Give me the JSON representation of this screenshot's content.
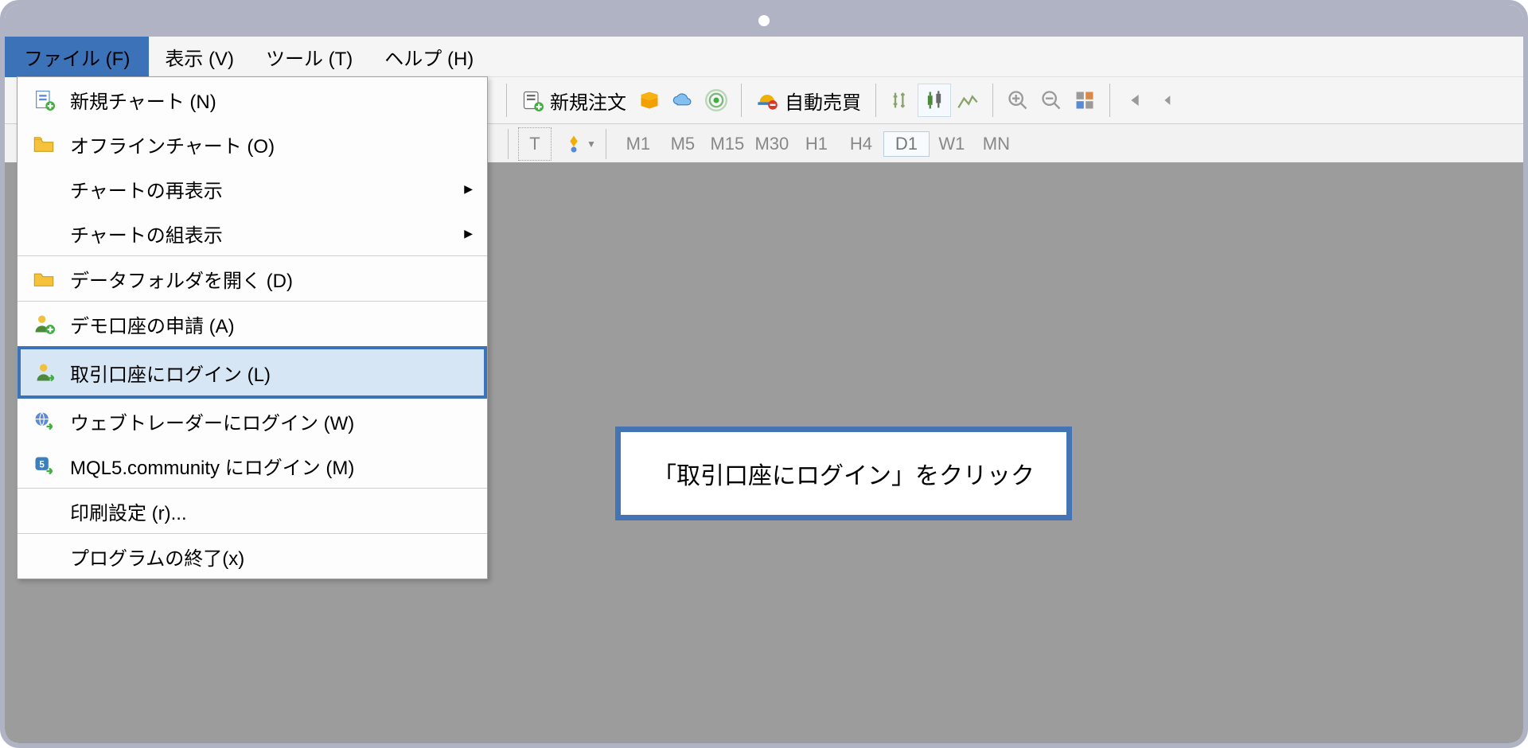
{
  "menubar": {
    "file": "ファイル (F)",
    "view": "表示 (V)",
    "tools": "ツール (T)",
    "help": "ヘルプ (H)"
  },
  "file_menu": {
    "new_chart": "新規チャート (N)",
    "offline_chart": "オフラインチャート (O)",
    "redisplay_chart": "チャートの再表示",
    "chart_group": "チャートの組表示",
    "open_data_folder": "データフォルダを開く (D)",
    "request_demo": "デモ口座の申請 (A)",
    "login_trade": "取引口座にログイン (L)",
    "login_webtrader": "ウェブトレーダーにログイン (W)",
    "login_mql5": "MQL5.community にログイン (M)",
    "print_setup": "印刷設定 (r)...",
    "exit": "プログラムの終了(x)"
  },
  "toolbar": {
    "new_order": "新規注文",
    "auto_trade": "自動売買"
  },
  "timeframes": {
    "m1": "M1",
    "m5": "M5",
    "m15": "M15",
    "m30": "M30",
    "h1": "H1",
    "h4": "H4",
    "d1": "D1",
    "w1": "W1",
    "mn": "MN"
  },
  "callout": {
    "text": "「取引口座にログイン」をクリック"
  }
}
